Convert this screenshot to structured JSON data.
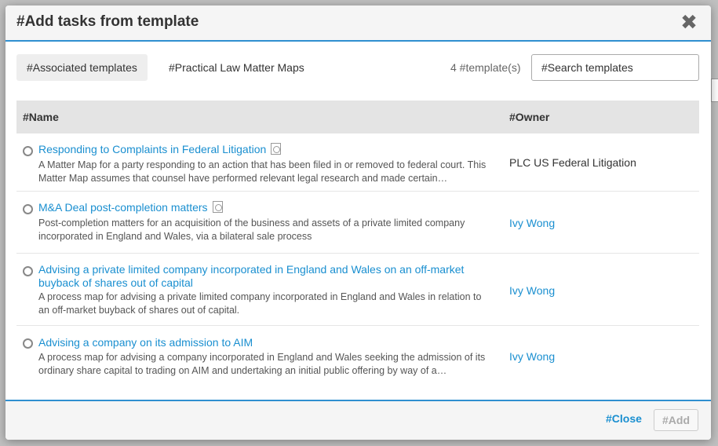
{
  "dialog": {
    "title": "#Add tasks from template",
    "close_symbol": "✖"
  },
  "tabs": [
    {
      "label": "#Associated templates",
      "active": true
    },
    {
      "label": "#Practical Law Matter Maps",
      "active": false
    }
  ],
  "template_count": "4 #template(s)",
  "search": {
    "placeholder": "#Search templates",
    "value": ""
  },
  "table": {
    "columns": [
      "#Name",
      "#Owner"
    ],
    "rows": [
      {
        "title": "Responding to Complaints in Federal Litigation",
        "has_doc_icon": true,
        "description": "A Matter Map for a party responding to an action that has been filed in or removed to federal court. This Matter Map assumes that counsel have performed relevant legal research and made certain…",
        "owner": "PLC US Federal Litigation",
        "owner_is_link": false
      },
      {
        "title": "M&A Deal post-completion matters",
        "has_doc_icon": true,
        "description": "Post-completion matters for an acquisition of the business and assets of a private limited company incorporated in England and Wales, via a bilateral sale process",
        "owner": "Ivy Wong",
        "owner_is_link": true
      },
      {
        "title": "Advising a private limited company incorporated in England and Wales on an off-market buyback of shares out of capital",
        "has_doc_icon": false,
        "description": "A process map for advising a private limited company incorporated in England and Wales in relation to an off-market buyback of shares out of capital.",
        "owner": "Ivy Wong",
        "owner_is_link": true
      },
      {
        "title": "Advising a company on its admission to AIM",
        "has_doc_icon": false,
        "description": "A process map for advising a company incorporated in England and Wales seeking the admission of its ordinary share capital to trading on AIM and undertaking an initial public offering by way of a…",
        "owner": "Ivy Wong",
        "owner_is_link": true
      }
    ]
  },
  "footer": {
    "close_label": "#Close",
    "add_label": "#Add"
  },
  "colors": {
    "accent": "#1a8fd0",
    "header_bg": "#f5f5f5",
    "table_header_bg": "#e4e4e4"
  }
}
